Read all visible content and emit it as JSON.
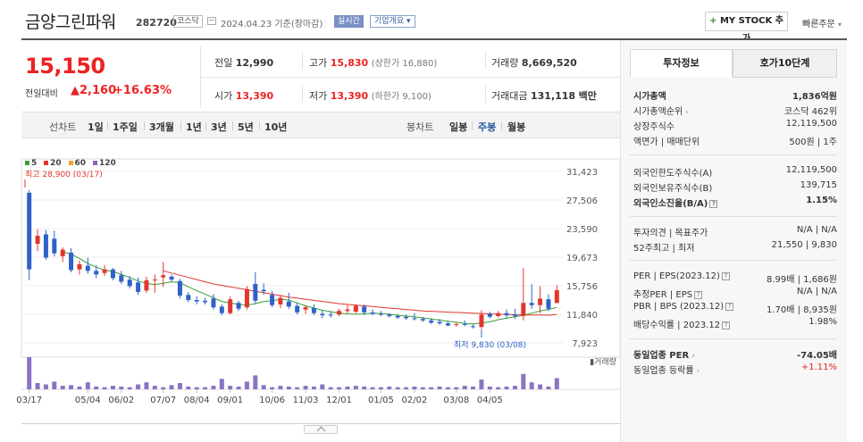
{
  "header": {
    "title": "금양그린파워",
    "code": "282720",
    "market_badge": "코스닥",
    "date": "2024.04.23 기준(장마감)",
    "realtime_badge": "실시간",
    "company_badge": "기업개요",
    "my_stock_plus": "+",
    "my_stock_label": "MY STOCK 추가",
    "quick_order_label": "빠른주문"
  },
  "quote": {
    "price": "15,150",
    "change_label": "전일대비",
    "change": "▲2,160",
    "change_pct": "+16.63%",
    "prev_close_label": "전일",
    "prev_close": "12,990",
    "open_label": "시가",
    "open": "13,390",
    "high_label": "고가",
    "high": "15,830",
    "upper_limit": "(상한가 16,880)",
    "low_label": "저가",
    "low": "13,390",
    "lower_limit": "(하한가 9,100)",
    "volume_label": "거래량",
    "volume": "8,669,520",
    "amount_label": "거래대금",
    "amount": "131,118",
    "amount_unit": "백만"
  },
  "periods": {
    "line_label": "선차트",
    "line_items": [
      "1일",
      "1주일",
      "3개월",
      "1년",
      "3년",
      "5년",
      "10년"
    ],
    "candle_label": "봉차트",
    "candle_items": [
      "일봉",
      "주봉",
      "월봉"
    ],
    "selected": "주봉"
  },
  "legend": [
    {
      "label": "5",
      "color": "#35a035"
    },
    {
      "label": "20",
      "color": "#e0362e"
    },
    {
      "label": "60",
      "color": "#f0a030"
    },
    {
      "label": "120",
      "color": "#9060c0"
    }
  ],
  "chart_data": {
    "type": "candlestick",
    "y_ticks": [
      "31,423",
      "27,506",
      "23,590",
      "19,673",
      "15,756",
      "11,840",
      "7,923"
    ],
    "ylim": [
      7923,
      31423
    ],
    "x_ticks": [
      "03/17",
      "05/04",
      "06/02",
      "07/07",
      "08/04",
      "09/01",
      "10/06",
      "11/03",
      "12/01",
      "01/05",
      "02/02",
      "03/08",
      "04/05"
    ],
    "high_annotation": "최고 28,900 (03/17)",
    "low_annotation": "최저 9,830 (03/08)",
    "volume_label": "거래량",
    "candles": [
      {
        "o": 28500,
        "h": 28900,
        "l": 16500,
        "c": 18000
      },
      {
        "o": 21500,
        "h": 23500,
        "l": 20500,
        "c": 22600
      },
      {
        "o": 22800,
        "h": 23400,
        "l": 19300,
        "c": 19600
      },
      {
        "o": 22200,
        "h": 23300,
        "l": 19800,
        "c": 20200
      },
      {
        "o": 19800,
        "h": 21000,
        "l": 19000,
        "c": 20700
      },
      {
        "o": 20300,
        "h": 20900,
        "l": 17600,
        "c": 17900
      },
      {
        "o": 18000,
        "h": 19200,
        "l": 17300,
        "c": 18700
      },
      {
        "o": 18500,
        "h": 19600,
        "l": 17400,
        "c": 17800
      },
      {
        "o": 17800,
        "h": 18600,
        "l": 16800,
        "c": 17300
      },
      {
        "o": 17500,
        "h": 18600,
        "l": 17100,
        "c": 18000
      },
      {
        "o": 18000,
        "h": 18200,
        "l": 16500,
        "c": 16800
      },
      {
        "o": 17200,
        "h": 17800,
        "l": 16000,
        "c": 16300
      },
      {
        "o": 16600,
        "h": 17100,
        "l": 15400,
        "c": 15700
      },
      {
        "o": 16200,
        "h": 16900,
        "l": 14500,
        "c": 14900
      },
      {
        "o": 15100,
        "h": 17000,
        "l": 14800,
        "c": 16500
      },
      {
        "o": 16500,
        "h": 17300,
        "l": 14800,
        "c": 16600
      },
      {
        "o": 16900,
        "h": 19000,
        "l": 15600,
        "c": 17200
      },
      {
        "o": 17000,
        "h": 17300,
        "l": 16300,
        "c": 16600
      },
      {
        "o": 16400,
        "h": 16700,
        "l": 14000,
        "c": 14400
      },
      {
        "o": 14500,
        "h": 14900,
        "l": 13500,
        "c": 13800
      },
      {
        "o": 13800,
        "h": 14300,
        "l": 13200,
        "c": 13600
      },
      {
        "o": 13700,
        "h": 14100,
        "l": 13200,
        "c": 13500
      },
      {
        "o": 14000,
        "h": 14600,
        "l": 12500,
        "c": 12800
      },
      {
        "o": 12900,
        "h": 13200,
        "l": 11700,
        "c": 12000
      },
      {
        "o": 12000,
        "h": 14300,
        "l": 11800,
        "c": 13900
      },
      {
        "o": 13400,
        "h": 13700,
        "l": 12300,
        "c": 12600
      },
      {
        "o": 12800,
        "h": 15700,
        "l": 12500,
        "c": 15300
      },
      {
        "o": 16000,
        "h": 17600,
        "l": 13300,
        "c": 13700
      },
      {
        "o": 15200,
        "h": 16100,
        "l": 14500,
        "c": 15000
      },
      {
        "o": 14500,
        "h": 15000,
        "l": 12800,
        "c": 13100
      },
      {
        "o": 13200,
        "h": 14500,
        "l": 12700,
        "c": 14100
      },
      {
        "o": 13600,
        "h": 14800,
        "l": 12600,
        "c": 12900
      },
      {
        "o": 13000,
        "h": 13400,
        "l": 11800,
        "c": 12100
      },
      {
        "o": 12500,
        "h": 13100,
        "l": 11900,
        "c": 12800
      },
      {
        "o": 12700,
        "h": 13200,
        "l": 11700,
        "c": 12000
      },
      {
        "o": 11900,
        "h": 12400,
        "l": 11300,
        "c": 11700
      },
      {
        "o": 11800,
        "h": 12300,
        "l": 11400,
        "c": 11700
      },
      {
        "o": 11800,
        "h": 12600,
        "l": 11600,
        "c": 12300
      },
      {
        "o": 12300,
        "h": 13100,
        "l": 12000,
        "c": 12500
      },
      {
        "o": 12200,
        "h": 13200,
        "l": 12000,
        "c": 13000
      },
      {
        "o": 12900,
        "h": 13200,
        "l": 11700,
        "c": 12100
      },
      {
        "o": 12100,
        "h": 12500,
        "l": 11700,
        "c": 11900
      },
      {
        "o": 11900,
        "h": 12300,
        "l": 11600,
        "c": 11800
      },
      {
        "o": 11800,
        "h": 12000,
        "l": 11400,
        "c": 11600
      },
      {
        "o": 11600,
        "h": 11900,
        "l": 11200,
        "c": 11400
      },
      {
        "o": 11500,
        "h": 11800,
        "l": 11100,
        "c": 11300
      },
      {
        "o": 11300,
        "h": 12000,
        "l": 11000,
        "c": 11200
      },
      {
        "o": 11200,
        "h": 11500,
        "l": 10800,
        "c": 11000
      },
      {
        "o": 11000,
        "h": 11300,
        "l": 10500,
        "c": 10700
      },
      {
        "o": 10800,
        "h": 11200,
        "l": 10400,
        "c": 10600
      },
      {
        "o": 10600,
        "h": 10900,
        "l": 10200,
        "c": 10300
      },
      {
        "o": 10400,
        "h": 10700,
        "l": 10100,
        "c": 10500
      },
      {
        "o": 10500,
        "h": 11000,
        "l": 10200,
        "c": 10400
      },
      {
        "o": 10200,
        "h": 10500,
        "l": 9900,
        "c": 10100
      },
      {
        "o": 10100,
        "h": 12400,
        "l": 9830,
        "c": 11800
      },
      {
        "o": 11900,
        "h": 12200,
        "l": 11300,
        "c": 11500
      },
      {
        "o": 11600,
        "h": 12300,
        "l": 11400,
        "c": 12000
      },
      {
        "o": 12000,
        "h": 12500,
        "l": 11400,
        "c": 11700
      },
      {
        "o": 11800,
        "h": 12600,
        "l": 11200,
        "c": 11600
      },
      {
        "o": 11600,
        "h": 18200,
        "l": 11000,
        "c": 13400
      },
      {
        "o": 13400,
        "h": 16000,
        "l": 12600,
        "c": 13100
      },
      {
        "o": 13100,
        "h": 15700,
        "l": 12000,
        "c": 14000
      },
      {
        "o": 13900,
        "h": 14600,
        "l": 12300,
        "c": 12600
      },
      {
        "o": 13390,
        "h": 15830,
        "l": 13390,
        "c": 15150
      }
    ],
    "ma20": [
      null,
      null,
      null,
      null,
      null,
      null,
      null,
      null,
      null,
      null,
      null,
      null,
      null,
      null,
      null,
      null,
      17800,
      17500,
      17200,
      16900,
      16600,
      16300,
      16000,
      15800,
      15600,
      15400,
      15200,
      15000,
      14800,
      14600,
      14400,
      14200,
      14050,
      13900,
      13750,
      13600,
      13450,
      13300,
      13200,
      13100,
      13000,
      12900,
      12800,
      12700,
      12600,
      12500,
      12400,
      12300,
      12250,
      12200,
      12150,
      12100,
      12050,
      12000,
      11950,
      11900,
      11850,
      11800,
      11780,
      11760,
      11750,
      11740,
      11720,
      11800
    ],
    "ma5": [
      null,
      null,
      null,
      null,
      20400,
      20100,
      19500,
      18800,
      18300,
      17900,
      17700,
      17300,
      16900,
      16400,
      16100,
      15900,
      16100,
      16300,
      16200,
      15600,
      15100,
      14600,
      14100,
      13600,
      13400,
      13200,
      13100,
      13300,
      13600,
      13700,
      13900,
      13800,
      13400,
      13000,
      12700,
      12400,
      12200,
      12000,
      11900,
      11850,
      11900,
      12000,
      11950,
      11850,
      11700,
      11600,
      11500,
      11350,
      11200,
      11050,
      10900,
      10750,
      10600,
      10500,
      10650,
      10800,
      11100,
      11300,
      11500,
      11700,
      12000,
      12300,
      12500,
      12800
    ],
    "volume": [
      92,
      18,
      14,
      22,
      10,
      12,
      8,
      20,
      8,
      6,
      10,
      8,
      6,
      14,
      20,
      10,
      6,
      12,
      18,
      8,
      6,
      6,
      10,
      30,
      10,
      8,
      22,
      40,
      12,
      6,
      10,
      8,
      6,
      10,
      8,
      14,
      6,
      6,
      8,
      10,
      8,
      6,
      6,
      8,
      6,
      6,
      8,
      6,
      6,
      8,
      6,
      6,
      10,
      8,
      28,
      8,
      6,
      8,
      10,
      44,
      20,
      14,
      8,
      32
    ]
  },
  "panel": {
    "tab_info": "투자정보",
    "tab_hoga": "호가10단계",
    "s1": [
      {
        "k": "시가총액",
        "v": "1,836억원",
        "bold": true
      },
      {
        "k": "시가총액순위",
        "v": "코스닥 462위",
        "arrow": true
      },
      {
        "k": "상장주식수",
        "v": "12,119,500"
      },
      {
        "k": "액면가 | 매매단위",
        "v": "500원 | 1주"
      }
    ],
    "s2": [
      {
        "k": "외국인한도주식수(A)",
        "v": "12,119,500"
      },
      {
        "k": "외국인보유주식수(B)",
        "v": "139,715"
      },
      {
        "k": "외국인소진율(B/A)",
        "v": "1.15%",
        "bold": true,
        "q": true
      }
    ],
    "s3": [
      {
        "k": "투자의견 | 목표주가",
        "v": "N/A | N/A"
      },
      {
        "k": "52주최고 | 최저",
        "v": "21,550 | 9,830"
      }
    ],
    "s4": [
      {
        "k": "PER | EPS(2023.12)",
        "v": "8.99배 | 1,686원",
        "q": true
      },
      {
        "k": "추정PER | EPS",
        "v": "N/A | N/A",
        "q": true
      },
      {
        "k": "PBR | BPS (2023.12)",
        "v": "1.70배 | 8,935원",
        "q": true
      },
      {
        "k": "배당수익률 | 2023.12",
        "v": "1.98%",
        "q": true
      }
    ],
    "s5": [
      {
        "k": "동일업종 PER",
        "v": "-74.05배",
        "bold": true,
        "arrow": true
      },
      {
        "k": "동일업종 등락률",
        "v": "+1.11%",
        "red": true,
        "arrow": true
      }
    ]
  }
}
